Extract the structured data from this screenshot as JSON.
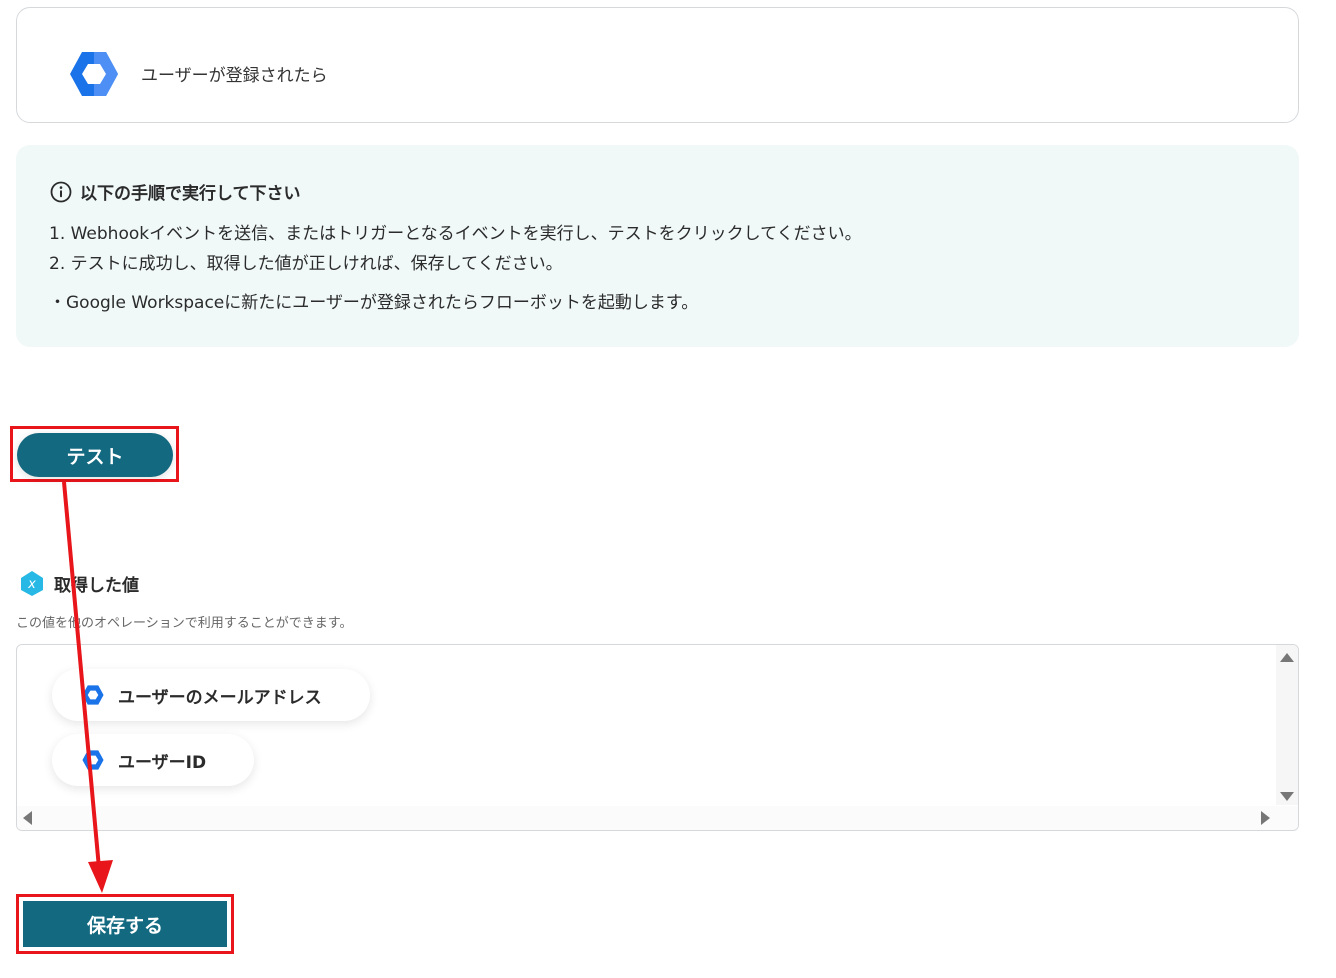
{
  "trigger": {
    "icon": "google-workspace-icon",
    "title": "ユーザーが登録されたら"
  },
  "instructions": {
    "heading": "以下の手順で実行して下さい",
    "steps": [
      "1. Webhookイベントを送信、またはトリガーとなるイベントを実行し、テストをクリックしてください。",
      "2. テストに成功し、取得した値が正しければ、保存してください。"
    ],
    "note": "・Google Workspaceに新たにユーザーが登録されたらフローボットを起動します。"
  },
  "test_button": {
    "label": "テスト"
  },
  "values": {
    "title": "取得した値",
    "description": "この値を他のオペレーションで利用することができます。",
    "items": [
      {
        "label": "ユーザーのメールアドレス",
        "icon": "google-workspace-icon"
      },
      {
        "label": "ユーザーID",
        "icon": "google-workspace-icon"
      }
    ]
  },
  "save_button": {
    "label": "保存する"
  },
  "colors": {
    "primary": "#13697f",
    "annotation": "#e8151b",
    "info_bg": "#f0f8f8",
    "workspace_blue": "#1a73e8"
  }
}
